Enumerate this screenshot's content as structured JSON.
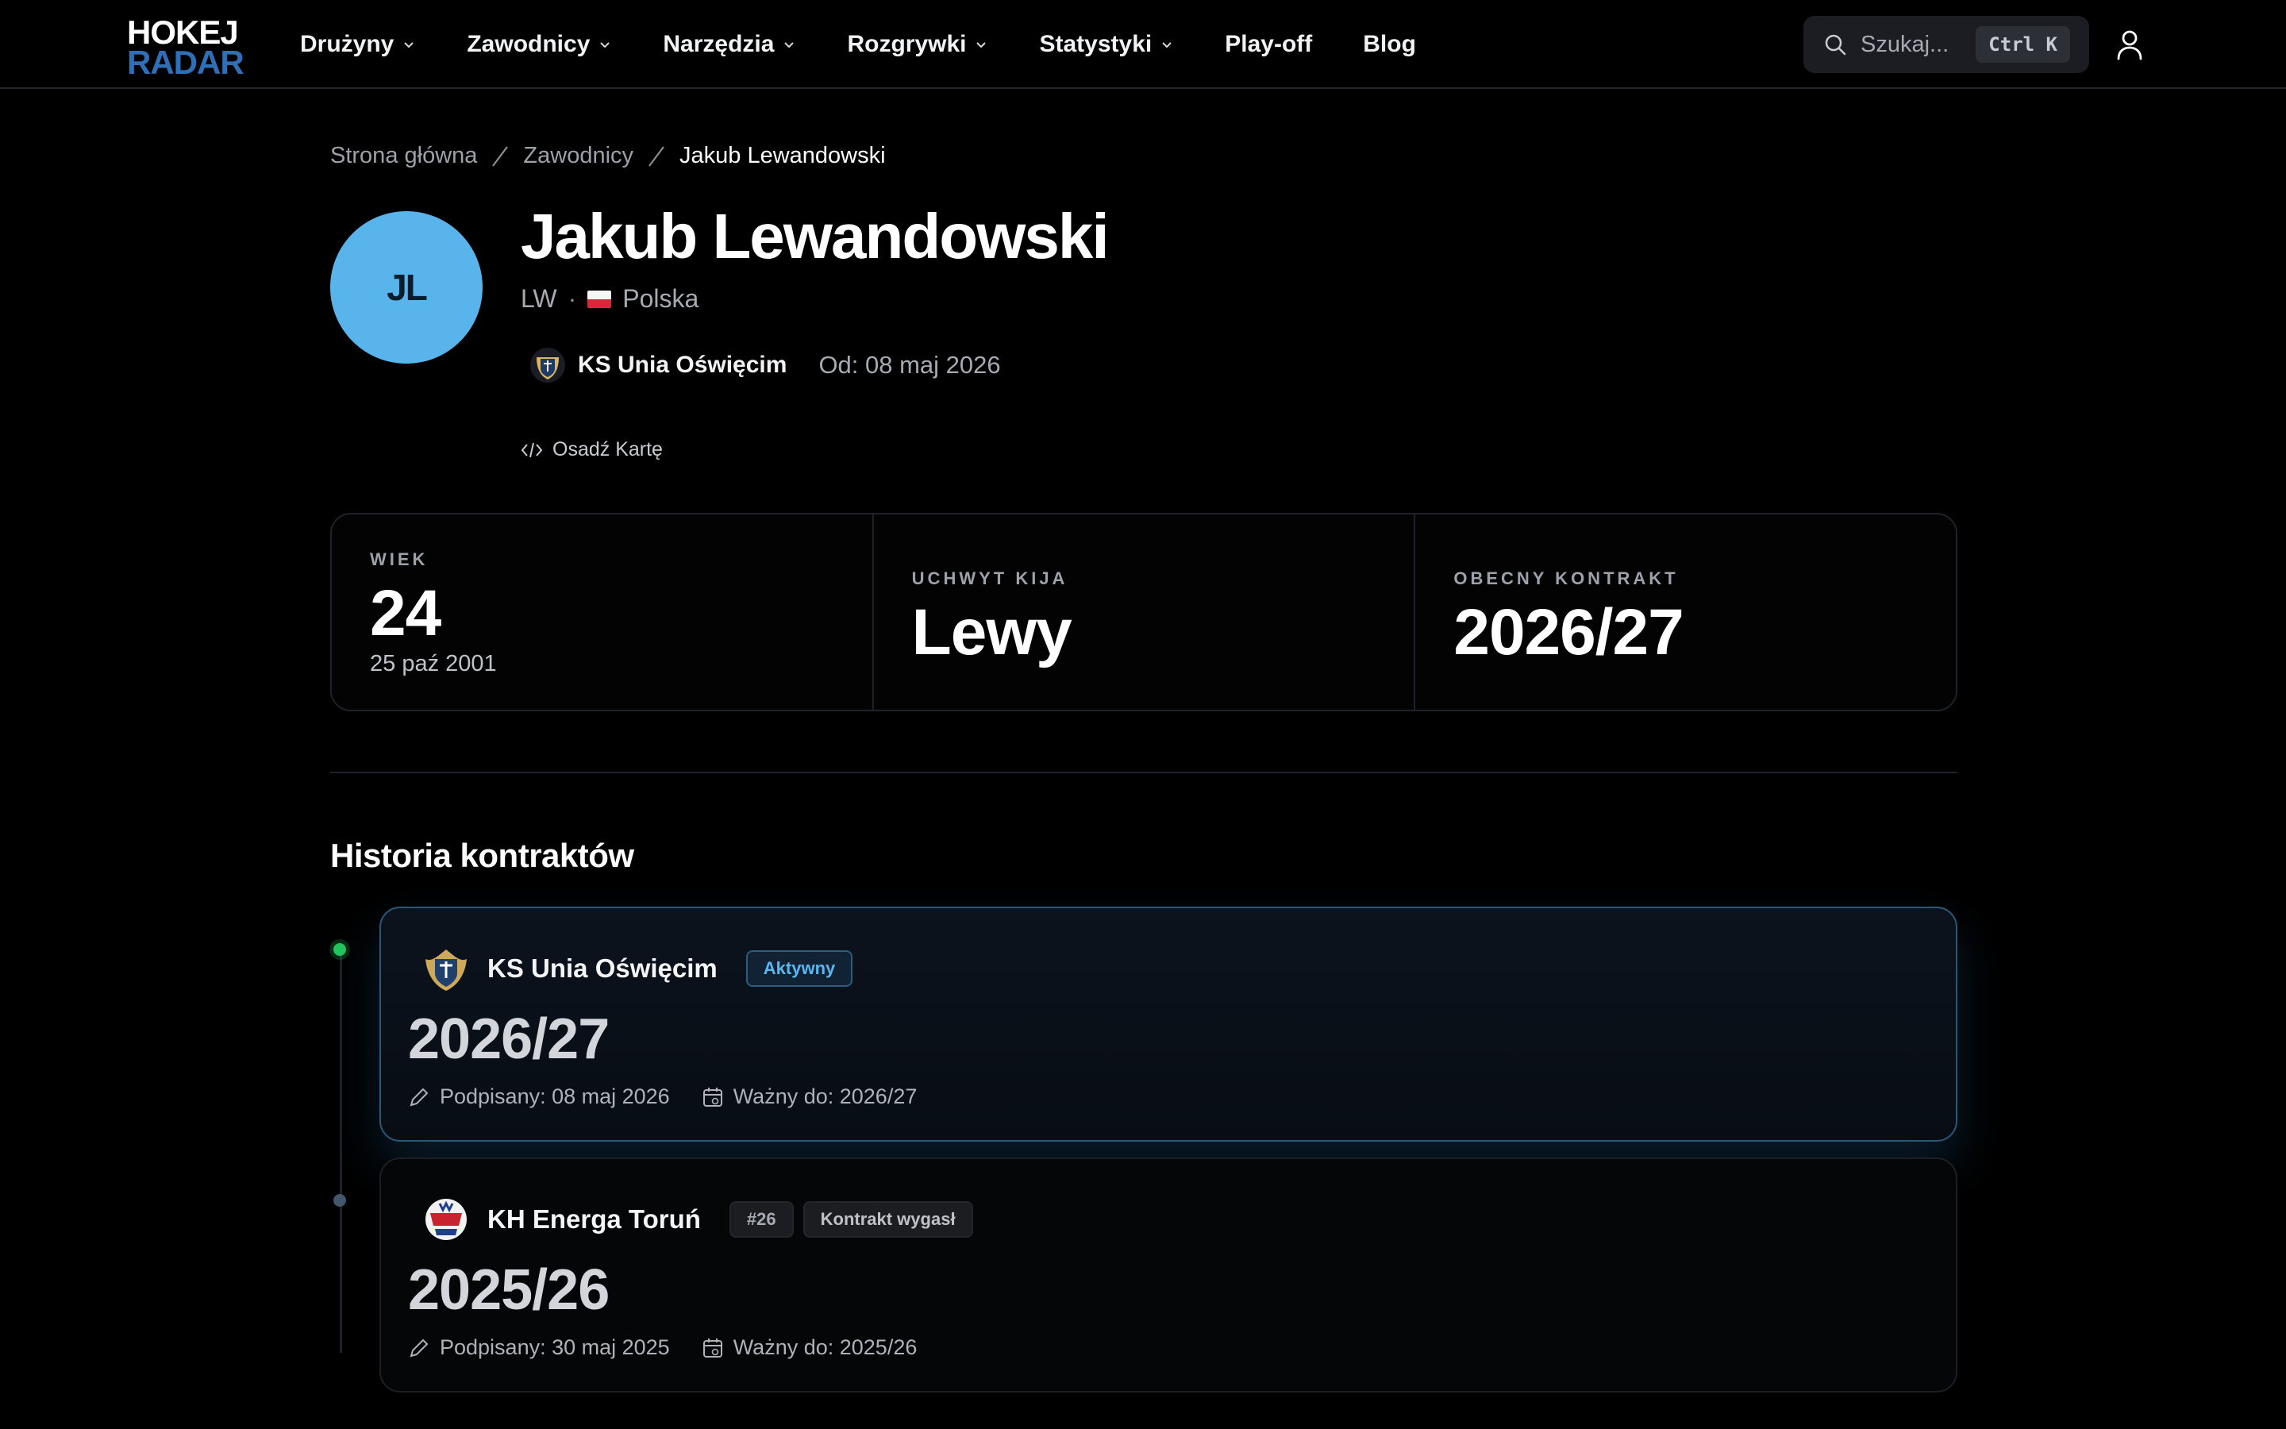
{
  "logo": {
    "line1": "HOKEJ",
    "line2": "RADAR"
  },
  "nav": {
    "items": [
      {
        "label": "Drużyny",
        "dropdown": true
      },
      {
        "label": "Zawodnicy",
        "dropdown": true
      },
      {
        "label": "Narzędzia",
        "dropdown": true
      },
      {
        "label": "Rozgrywki",
        "dropdown": true
      },
      {
        "label": "Statystyki",
        "dropdown": true
      },
      {
        "label": "Play-off",
        "dropdown": false
      },
      {
        "label": "Blog",
        "dropdown": false
      }
    ]
  },
  "search": {
    "placeholder": "Szukaj...",
    "shortcut": "Ctrl K"
  },
  "breadcrumb": {
    "home": "Strona główna",
    "section": "Zawodnicy",
    "current": "Jakub Lewandowski"
  },
  "player": {
    "initials": "JL",
    "name": "Jakub Lewandowski",
    "position": "LW",
    "country": "Polska",
    "team": "KS Unia Oświęcim",
    "since": "Od: 08 maj 2026",
    "embed_label": "Osadź Kartę"
  },
  "stats": {
    "age": {
      "label": "WIEK",
      "value": "24",
      "sub": "25 paź 2001"
    },
    "grip": {
      "label": "UCHWYT KIJA",
      "value": "Lewy"
    },
    "contract": {
      "label": "OBECNY KONTRAKT",
      "value": "2026/27"
    }
  },
  "history": {
    "title": "Historia kontraktów",
    "contracts": [
      {
        "team": "KS Unia Oświęcim",
        "badge": "Aktywny",
        "season": "2026/27",
        "signed": "Podpisany: 08 maj 2026",
        "valid": "Ważny do: 2026/27"
      },
      {
        "team": "KH Energa Toruń",
        "number": "#26",
        "badge": "Kontrakt wygasł",
        "season": "2025/26",
        "signed": "Podpisany: 30 maj 2025",
        "valid": "Ważny do: 2025/26"
      }
    ]
  },
  "colors": {
    "accent": "#58b4ea",
    "active_dot": "#22c55e",
    "logo_blue": "#2e6fb8",
    "background": "#000000"
  },
  "icons": {
    "search": "search-icon",
    "user": "user-icon",
    "chevron": "chevron-down-icon",
    "embed": "code-icon",
    "signed": "pen-icon",
    "valid": "calendar-icon"
  }
}
